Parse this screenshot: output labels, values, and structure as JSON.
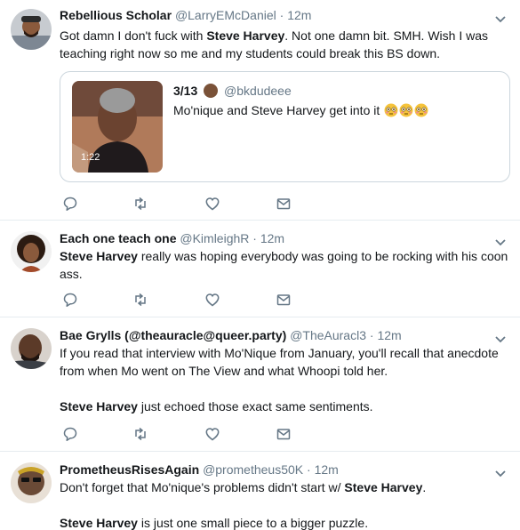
{
  "tweets": [
    {
      "name": "Rebellious Scholar",
      "handle": "@LarryEMcDaniel",
      "time": "12m",
      "text_segments": [
        "Got damn I don't fuck with ",
        "Steve Harvey",
        ". Not one damn bit. SMH. Wish I was teaching right now so me and my students could break this BS down."
      ],
      "quote": {
        "name": "3/13",
        "handle": "@bkdudeee",
        "text": "Mo'nique and Steve Harvey get into it",
        "duration": "1:22"
      }
    },
    {
      "name": "Each one teach one",
      "handle": "@KimleighR",
      "time": "12m",
      "text_segments": [
        "Steve Harvey",
        " really was hoping everybody was going to be rocking with his coon ass."
      ]
    },
    {
      "name": "Bae Grylls (@theauracle@queer.party)",
      "handle": "@TheAuracl3",
      "time": "12m",
      "text_segments": [
        "If you read that interview with Mo'Nique from January, you'll recall that anecdote from when Mo went on The View and what Whoopi told her.",
        "Steve Harvey",
        " just echoed those exact same sentiments."
      ]
    },
    {
      "name": "PrometheusRisesAgain",
      "handle": "@prometheus50K",
      "time": "12m",
      "text_segments": [
        "Don't forget that Mo'nique's problems didn't start w/ ",
        "Steve Harvey",
        ".",
        "Steve Harvey",
        " is just one small piece to a bigger puzzle."
      ]
    }
  ],
  "separator": "·",
  "icons": [
    "reply-icon",
    "retweet-icon",
    "like-icon",
    "dm-icon",
    "caret-down-icon",
    "flushed-face-emoji"
  ],
  "colors": {
    "name": "#14171a",
    "meta": "#657786",
    "icon": "#657786",
    "border": "#e6ecf0"
  }
}
